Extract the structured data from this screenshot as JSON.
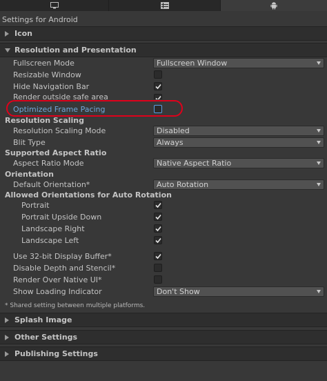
{
  "window": {
    "title": "Settings for Android"
  },
  "tabs": [
    {
      "icon": "monitor-icon"
    },
    {
      "icon": "grid-icon"
    },
    {
      "icon": "android-icon"
    }
  ],
  "sections": {
    "icon": "Icon",
    "resolution": "Resolution and Presentation",
    "splash": "Splash Image",
    "other": "Other Settings",
    "publishing": "Publishing Settings"
  },
  "resolution": {
    "fullscreen_mode": {
      "label": "Fullscreen Mode",
      "value": "Fullscreen Window"
    },
    "resizable_window": {
      "label": "Resizable Window",
      "checked": false
    },
    "hide_navigation_bar": {
      "label": "Hide Navigation Bar",
      "checked": true
    },
    "render_safe_area": {
      "label": "Render outside safe area",
      "checked": true
    },
    "optimized_frame_pacing": {
      "label": "Optimized Frame Pacing",
      "checked": false
    },
    "scaling_heading": "Resolution Scaling",
    "scaling_mode": {
      "label": "Resolution Scaling Mode",
      "value": "Disabled"
    },
    "blit_type": {
      "label": "Blit Type",
      "value": "Always"
    },
    "aspect_heading": "Supported Aspect Ratio",
    "aspect_mode": {
      "label": "Aspect Ratio Mode",
      "value": "Native Aspect Ratio"
    },
    "orientation_heading": "Orientation",
    "default_orientation": {
      "label": "Default Orientation*",
      "value": "Auto Rotation"
    },
    "allowed_heading": "Allowed Orientations for Auto Rotation",
    "portrait": {
      "label": "Portrait",
      "checked": true
    },
    "portrait_upside_down": {
      "label": "Portrait Upside Down",
      "checked": true
    },
    "landscape_right": {
      "label": "Landscape Right",
      "checked": true
    },
    "landscape_left": {
      "label": "Landscape Left",
      "checked": true
    },
    "display_buffer_32": {
      "label": "Use 32-bit Display Buffer*",
      "checked": true
    },
    "disable_depth_stencil": {
      "label": "Disable Depth and Stencil*",
      "checked": false
    },
    "render_over_native_ui": {
      "label": "Render Over Native UI*",
      "checked": false
    },
    "show_loading_indicator": {
      "label": "Show Loading Indicator",
      "value": "Don't Show"
    },
    "note": "* Shared setting between multiple platforms."
  },
  "colors": {
    "annotation": "#e0001b",
    "highlight_text": "#6fa8dc",
    "background": "#383838"
  }
}
